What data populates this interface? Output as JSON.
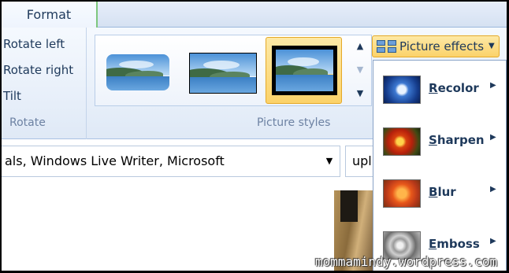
{
  "tabs": {
    "active_label": "Format"
  },
  "rotate_group": {
    "items": [
      "Rotate left",
      "Rotate right",
      "Tilt"
    ],
    "group_label": "Rotate"
  },
  "picture_styles": {
    "group_label": "Picture styles",
    "thumbnails": [
      "rounded-edges",
      "thin-black-border",
      "thick-black-border"
    ],
    "selected_index": 2
  },
  "picture_effects": {
    "button_label": "Picture effects",
    "icon": "picture-effects-icon",
    "menu_items": [
      {
        "label": "Recolor",
        "access_key": "R",
        "rest": "ecolor",
        "icon": "recolor-icon"
      },
      {
        "label": "Sharpen",
        "access_key": "S",
        "rest": "harpen",
        "icon": "sharpen-icon"
      },
      {
        "label": "Blur",
        "access_key": "B",
        "rest": "lur",
        "icon": "blur-icon"
      },
      {
        "label": "Emboss",
        "access_key": "E",
        "rest": "mboss",
        "icon": "emboss-icon"
      }
    ]
  },
  "tags_field": {
    "value": "als, Windows Live Writer, Microsoft"
  },
  "secondary_field": {
    "value": "upl"
  },
  "watermark": "mommamindy.wordpress.com",
  "colors": {
    "accent_highlight": "#fbd26a",
    "ribbon_bg": "#e6eef9",
    "text": "#1e395b"
  }
}
